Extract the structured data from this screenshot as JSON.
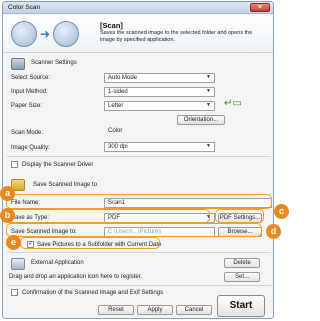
{
  "window": {
    "title": "Color Scan",
    "close_label": "×"
  },
  "banner": {
    "title": "[Scan]",
    "description": "Saves the scanned image to the selected folder and opens the image by specified application."
  },
  "scanner_settings": {
    "heading": "Scanner Settings",
    "select_source": {
      "label": "Select Source:",
      "value": "Auto Mode"
    },
    "input_method": {
      "label": "Input Method:",
      "value": "1-sided"
    },
    "paper_size": {
      "label": "Paper Size:",
      "value": "Letter"
    },
    "orientation_button": "Orientation...",
    "scan_mode": {
      "label": "Scan Mode:",
      "value": "Color"
    },
    "image_quality": {
      "label": "Image Quality:",
      "value": "300 dpi"
    },
    "display_driver_label": "Display the Scanner Driver"
  },
  "save": {
    "heading": "Save Scanned Image to",
    "file_name": {
      "label": "File Name:",
      "value": "Scan1"
    },
    "save_as_type": {
      "label": "Save as Type:",
      "value": "PDF"
    },
    "pdf_settings_button": "PDF Settings...",
    "save_to": {
      "label": "Save Scanned Image to:",
      "value": "C:\\Users\\...\\Pictures"
    },
    "browse_button": "Browse...",
    "subfolder_label": "Save Pictures to a Subfolder with Current Date",
    "subfolder_checked": true
  },
  "external_app": {
    "heading": "External Application",
    "hint": "Drag and drop an application icon here to register.",
    "delete_button": "Delete",
    "set_button": "Set..."
  },
  "footer": {
    "confirm_label": "Confirmation of the Scanned Image and Exif Settings",
    "reset_button": "Reset",
    "apply_button": "Apply",
    "cancel_button": "Cancel",
    "start_button": "Start"
  },
  "callouts": [
    "a",
    "b",
    "c",
    "d",
    "e"
  ],
  "colors": {
    "callout": "#e88a1e",
    "banner_icon_ring": "#7890ad",
    "arrow": "#3b7bd0"
  }
}
